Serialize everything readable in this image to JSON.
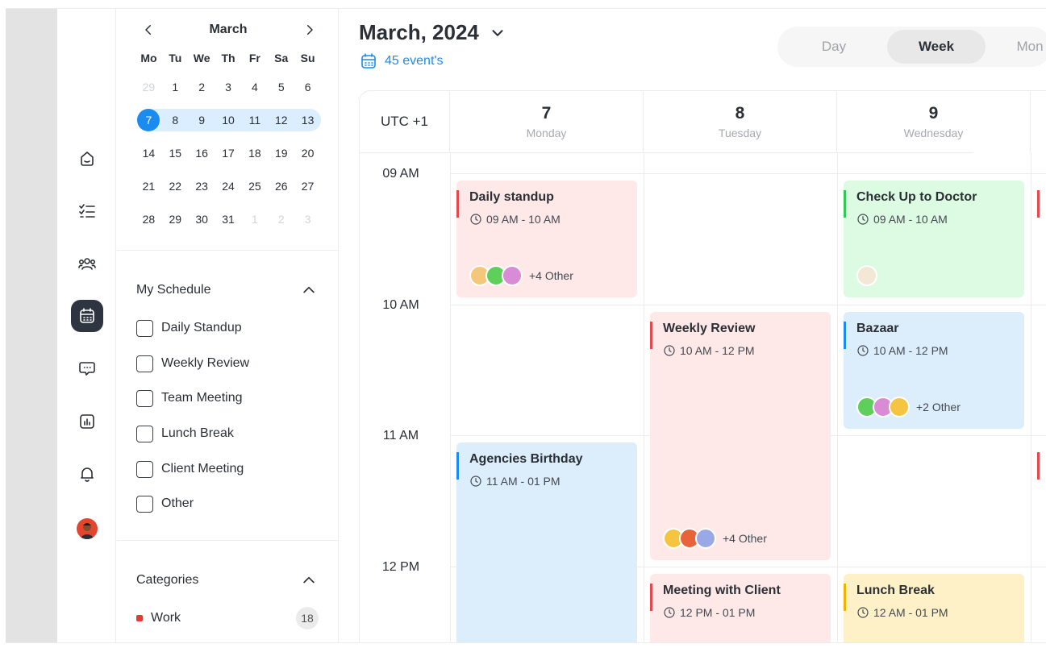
{
  "rail": {
    "icons": [
      "home-icon",
      "tasks-icon",
      "team-icon",
      "calendar-icon",
      "chat-icon",
      "analytics-icon",
      "bell-icon"
    ],
    "active": "calendar-icon",
    "avatar_color": "#e2462f"
  },
  "mini_calendar": {
    "month": "March",
    "weekdays": [
      "Mo",
      "Tu",
      "We",
      "Th",
      "Fr",
      "Sa",
      "Su"
    ],
    "weeks": [
      [
        "29",
        "1",
        "2",
        "3",
        "4",
        "5",
        "6"
      ],
      [
        "7",
        "8",
        "9",
        "10",
        "11",
        "12",
        "13"
      ],
      [
        "14",
        "15",
        "16",
        "17",
        "18",
        "19",
        "20"
      ],
      [
        "21",
        "22",
        "23",
        "24",
        "25",
        "26",
        "27"
      ],
      [
        "28",
        "29",
        "30",
        "31",
        "1",
        "2",
        "3"
      ]
    ],
    "selected_day": "7",
    "accent": "#1a8cf0"
  },
  "schedule": {
    "title": "My Schedule",
    "items": [
      "Daily Standup",
      "Weekly Review",
      "Team Meeting",
      "Lunch Break",
      "Client Meeting",
      "Other"
    ]
  },
  "categories": {
    "title": "Categories",
    "items": [
      {
        "label": "Work",
        "count": "18",
        "color": "#e53935"
      }
    ]
  },
  "header": {
    "title": "March, 2024",
    "events_label": "45 event's",
    "views": [
      "Day",
      "Week",
      "Mon"
    ],
    "active_view": "Week"
  },
  "grid": {
    "timezone": "UTC +1",
    "days": [
      {
        "num": "7",
        "name": "Monday"
      },
      {
        "num": "8",
        "name": "Tuesday"
      },
      {
        "num": "9",
        "name": "Wednesday"
      }
    ],
    "times": [
      "09 AM",
      "10 AM",
      "11 AM",
      "12 PM"
    ]
  },
  "events": [
    {
      "title": "Daily standup",
      "time": "09 AM - 10 AM",
      "color": "red",
      "more": "+4 Other"
    },
    {
      "title": "Check Up to Doctor",
      "time": "09 AM - 10 AM",
      "color": "green"
    },
    {
      "title": "Weekly Review",
      "time": "10 AM - 12 PM",
      "color": "red",
      "more": "+4 Other"
    },
    {
      "title": "Bazaar",
      "time": "10 AM - 12 PM",
      "color": "blue",
      "more": "+2 Other"
    },
    {
      "title": "Agencies Birthday",
      "time": "11 AM - 01 PM",
      "color": "blue"
    },
    {
      "title": "Meeting with Client",
      "time": "12 PM - 01 PM",
      "color": "red"
    },
    {
      "title": "Lunch Break",
      "time": "12 AM - 01 PM",
      "color": "yellow"
    }
  ]
}
